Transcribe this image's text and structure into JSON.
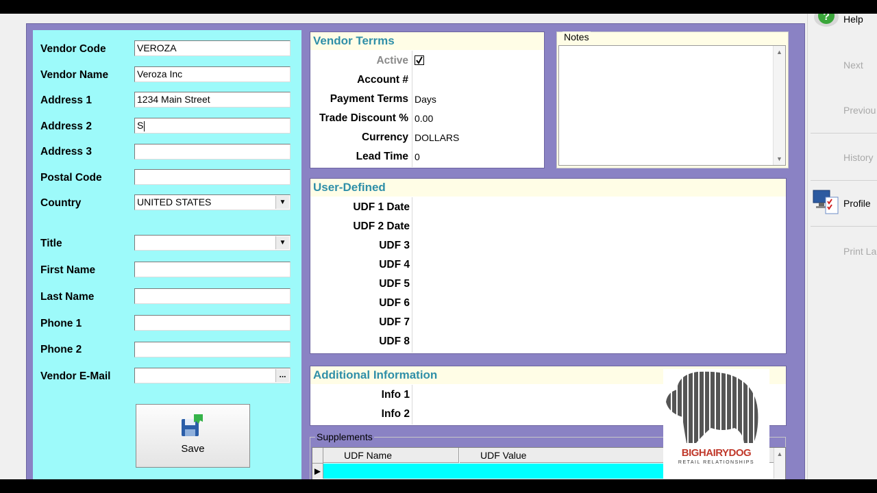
{
  "vendor_form": {
    "fields": [
      {
        "label": "Vendor Code",
        "value": "VEROZA"
      },
      {
        "label": "Vendor Name",
        "value": "Veroza Inc"
      },
      {
        "label": "Address 1",
        "value": "1234 Main Street"
      },
      {
        "label": "Address 2",
        "value": "S"
      },
      {
        "label": "Address 3",
        "value": ""
      },
      {
        "label": "Postal Code",
        "value": ""
      },
      {
        "label": "Country",
        "value": "UNITED STATES"
      },
      {
        "label": "Title",
        "value": ""
      },
      {
        "label": "First Name",
        "value": ""
      },
      {
        "label": "Last Name",
        "value": ""
      },
      {
        "label": "Phone 1",
        "value": ""
      },
      {
        "label": "Phone 2",
        "value": ""
      },
      {
        "label": "Vendor E-Mail",
        "value": ""
      }
    ],
    "ellipsis": "...",
    "save_label": "Save"
  },
  "vendor_terms": {
    "title": "Vendor Terrms",
    "rows": [
      {
        "label": "Active",
        "value": ""
      },
      {
        "label": "Account #",
        "value": ""
      },
      {
        "label": "Payment Terms",
        "value": "Days"
      },
      {
        "label": "Trade Discount %",
        "value": "0.00"
      },
      {
        "label": "Currency",
        "value": "DOLLARS"
      },
      {
        "label": "Lead Time",
        "value": "0"
      }
    ],
    "active_checked": true
  },
  "notes": {
    "legend": "Notes",
    "value": ""
  },
  "user_defined": {
    "title": "User-Defined",
    "rows": [
      "UDF 1 Date",
      "UDF 2 Date",
      "UDF 3",
      "UDF 4",
      "UDF 5",
      "UDF 6",
      "UDF 7",
      "UDF 8"
    ]
  },
  "additional_info": {
    "title": "Additional Information",
    "rows": [
      "Info 1",
      "Info 2"
    ]
  },
  "supplements": {
    "legend": "Supplements",
    "columns": [
      "UDF Name",
      "UDF Value"
    ]
  },
  "sidebar": {
    "help": "Help",
    "next": "Next",
    "previous": "Previou",
    "history": "History",
    "profile": "Profile",
    "print_labels": "Print La"
  },
  "watermark": {
    "brand": "BIGHAIRYDOG",
    "tagline": "RETAIL RELATIONSHIPS"
  },
  "colors": {
    "left_panel": "#9dfafa",
    "frame": "#8a82c4",
    "group_header": "#fffde6",
    "header_text": "#2f8fa8",
    "selection": "#00ffff"
  }
}
